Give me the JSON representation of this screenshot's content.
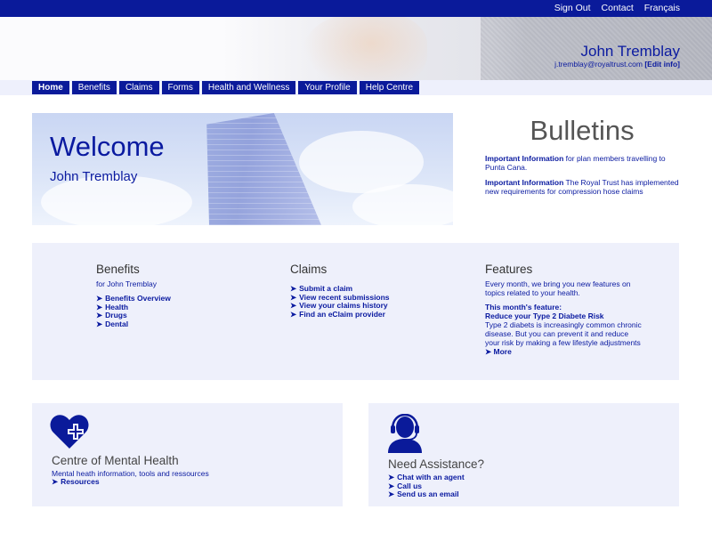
{
  "top_links": [
    "Sign Out",
    "Contact",
    "Français"
  ],
  "user": {
    "name": "John Tremblay",
    "email": "j.tremblay@royaltrust.com",
    "edit_label": "[Edit info]"
  },
  "nav": [
    "Home",
    "Benefits",
    "Claims",
    "Forms",
    "Health and Wellness",
    "Your Profile",
    "Help Centre"
  ],
  "welcome": {
    "title": "Welcome",
    "name": "John Tremblay"
  },
  "bulletins": {
    "title": "Bulletins",
    "items": [
      {
        "label": "Important Information",
        "text": " for plan members travelling to Punta Cana."
      },
      {
        "label": "Important Information",
        "text": " The Royal Trust has implemented new requirements for compression hose claims"
      }
    ]
  },
  "benefits": {
    "title": "Benefits",
    "sub": "for John Tremblay",
    "links": [
      "Benefits Overview",
      "Health",
      "Drugs",
      "Dental"
    ]
  },
  "claims": {
    "title": "Claims",
    "links": [
      "Submit a claim",
      "View recent submissions",
      "View your claims history",
      "Find an eClaim provider"
    ]
  },
  "features": {
    "title": "Features",
    "intro": "Every month, we bring you new features on topics related to your health.",
    "month_label": "This month's feature:",
    "feature_title": "Reduce your Type 2 Diabete Risk",
    "feature_text": "Type 2 diabets is increasingly common chronic disease. But you can prevent it and reduce your risk by making a few lifestyle adjustments",
    "more": "More"
  },
  "mental_health": {
    "title": "Centre of Mental Health",
    "sub": "Mental heath information, tools and ressources",
    "links": [
      "Resources"
    ]
  },
  "assistance": {
    "title": "Need Assistance?",
    "links": [
      "Chat with an agent",
      "Call us",
      "Send us an email"
    ]
  },
  "colors": {
    "brand_blue": "#0a1a9a",
    "panel_bg": "#eef0fb"
  },
  "icons": {
    "arrow": "➤",
    "mental_health": "heart-plus-icon",
    "assistance": "headset-agent-icon"
  }
}
